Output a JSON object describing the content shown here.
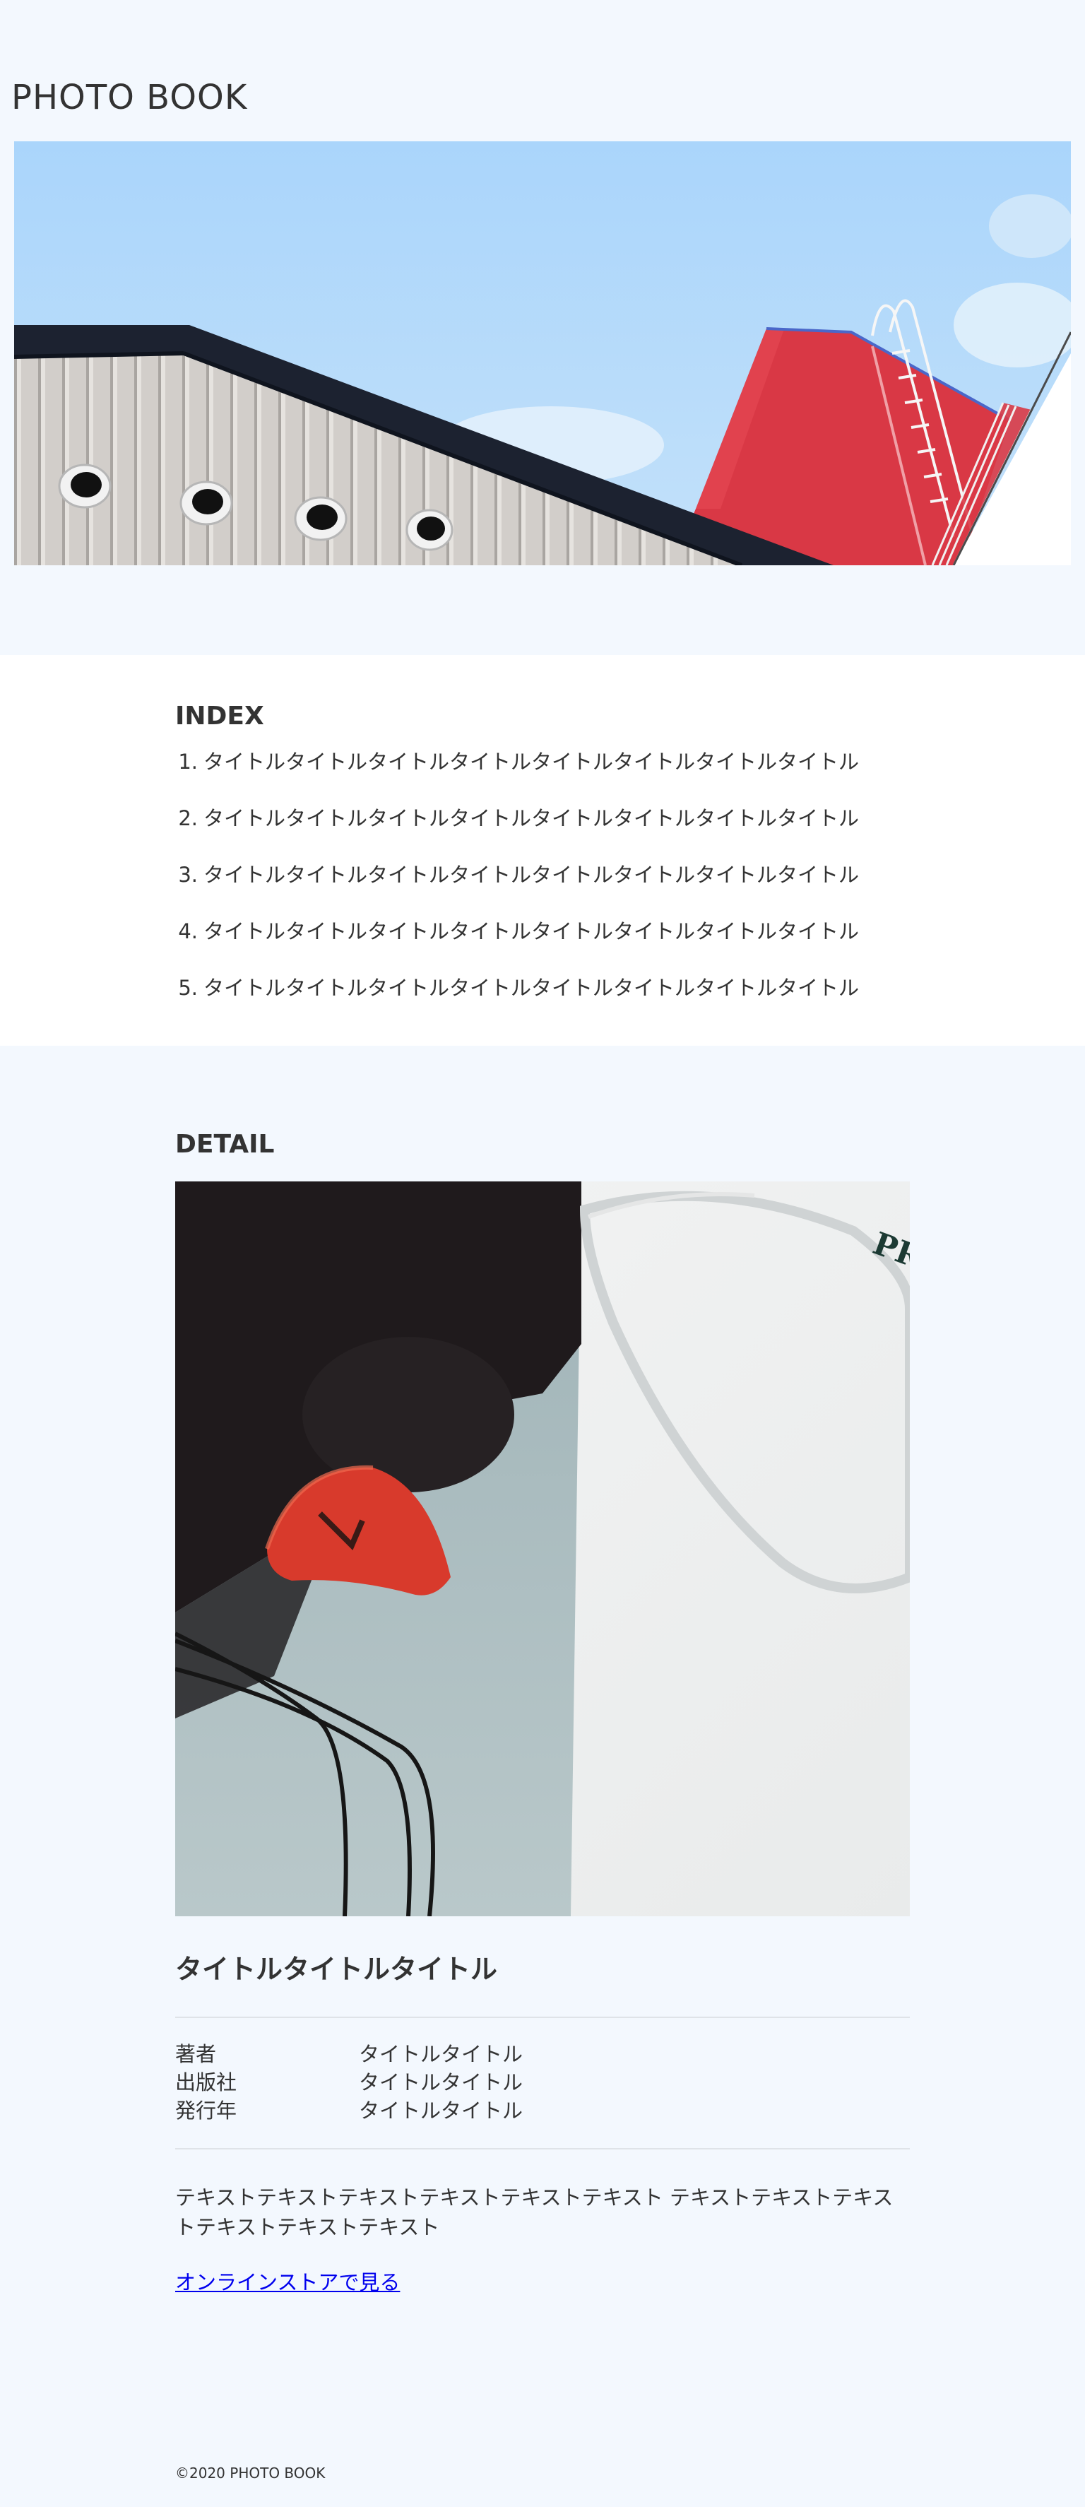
{
  "site": {
    "title": "PHOTO BOOK"
  },
  "index": {
    "heading": "INDEX",
    "items": [
      {
        "num": "1.",
        "label": "タイトルタイトルタイトルタイトルタイトルタイトルタイトルタイトル"
      },
      {
        "num": "2.",
        "label": "タイトルタイトルタイトルタイトルタイトルタイトルタイトルタイトル"
      },
      {
        "num": "3.",
        "label": "タイトルタイトルタイトルタイトルタイトルタイトルタイトルタイトル"
      },
      {
        "num": "4.",
        "label": "タイトルタイトルタイトルタイトルタイトルタイトルタイトルタイトル"
      },
      {
        "num": "5.",
        "label": "タイトルタイトルタイトルタイトルタイトルタイトルタイトルタイトル"
      }
    ]
  },
  "detail": {
    "heading": "DETAIL",
    "book_title": "タイトルタイトルタイトル",
    "meta": [
      {
        "key": "著者",
        "value": "タイトルタイトル"
      },
      {
        "key": "出版社",
        "value": "タイトルタイトル"
      },
      {
        "key": "発行年",
        "value": "タイトルタイトル"
      }
    ],
    "description": "テキストテキストテキストテキストテキストテキスト テキストテキストテキストテキストテキストテキスト",
    "store_link": "オンラインストアで見る",
    "photo_logo_text": "PRA"
  },
  "footer": {
    "copyright": "©2020 PHOTO BOOK"
  },
  "colors": {
    "background": "#f3f8fe",
    "index_background": "#ffffff",
    "text": "#333333",
    "link": "#0000ee",
    "sky": "#aed7fb",
    "building_red": "#d93845",
    "roof_dark": "#1c2230"
  }
}
